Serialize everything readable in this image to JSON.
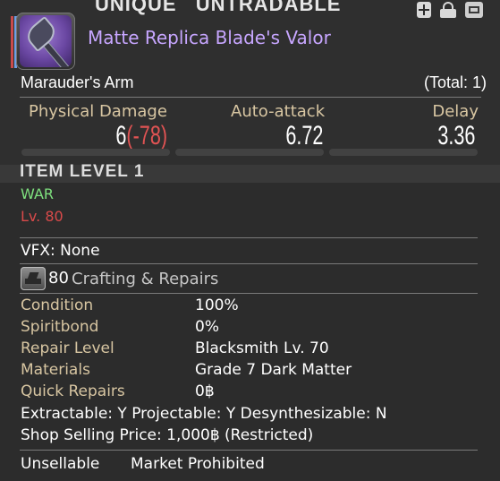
{
  "header": {
    "flags": [
      "UNIQUE",
      "UNTRADABLE"
    ],
    "icons": [
      "materia-meld-icon",
      "inventory-bag-icon",
      "glamour-dresser-icon"
    ],
    "item_icon": "greataxe-icon",
    "item_name": "Matte Replica Blade's Valor",
    "item_category": "Marauder's Arm",
    "total": "(Total: 1)"
  },
  "stats": {
    "physical_damage": {
      "label": "Physical Damage",
      "value": "6",
      "delta": "(-78)"
    },
    "auto_attack": {
      "label": "Auto-attack",
      "value": "6.72"
    },
    "delay": {
      "label": "Delay",
      "value": "3.36"
    }
  },
  "item_level": "ITEM LEVEL 1",
  "job": "WAR",
  "required_level": "Lv. 80",
  "vfx": "VFX: None",
  "crafting": {
    "icon": "anvil-icon",
    "number": "80",
    "label": "Crafting & Repairs"
  },
  "details": [
    {
      "key": "Condition",
      "value": "100%"
    },
    {
      "key": "Spiritbond",
      "value": "0%"
    },
    {
      "key": "Repair Level",
      "value": "Blacksmith Lv. 70"
    },
    {
      "key": "Materials",
      "value": "Grade 7 Dark Matter"
    },
    {
      "key": "Quick Repairs",
      "value": "0฿"
    }
  ],
  "properties": "Extractable: Y  Projectable: Y  Desynthesizable: N",
  "shop_price": "Shop Selling Price: 1,000฿ (Restricted)",
  "footer": {
    "unsellable": "Unsellable",
    "market": "Market Prohibited"
  },
  "colors": {
    "name": "#c7a6ff",
    "stat_label": "#d8c6a2",
    "job": "#7ee07e",
    "required_level": "#d94a4a",
    "delta": "#e05353"
  }
}
